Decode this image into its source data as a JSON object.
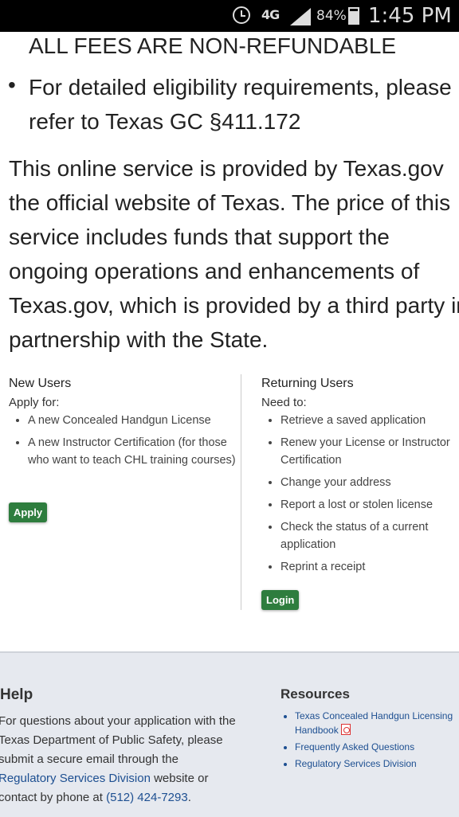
{
  "status_bar": {
    "network": "4G",
    "battery": "84%",
    "time": "1:45 PM"
  },
  "notice": {
    "fees": "ALL FEES ARE NON-REFUNDABLE",
    "eligibility": "For detailed eligibility requirements, please refer to Texas GC §411.172"
  },
  "service_text": "This online service is provided by Texas.gov the official website of Texas. The price of this service includes funds that support the ongoing operations and enhancements of Texas.gov, which is provided by a third party in partnership with the State.",
  "new_users": {
    "title": "New Users",
    "subtitle": "Apply for:",
    "items": [
      "A new Concealed Handgun License",
      "A new Instructor Certification (for those who want to teach CHL training courses)"
    ],
    "button": "Apply"
  },
  "returning_users": {
    "title": "Returning Users",
    "subtitle": "Need to:",
    "items": [
      "Retrieve a saved application",
      "Renew your License or Instructor Certification",
      "Change your address",
      "Report a lost or stolen license",
      "Check the status of a current application",
      "Reprint a receipt"
    ],
    "button": "Login"
  },
  "footer": {
    "help_title": "Help",
    "help_text_1": "For questions about your application with the Texas Department of Public Safety, please submit a secure email through the",
    "help_link": "Regulatory Services Division",
    "help_text_2": "website or contact by phone at",
    "help_phone": "(512) 424-7293",
    "help_end": ".",
    "resources_title": "Resources",
    "resources": [
      "Texas Concealed Handgun Licensing Handbook",
      "Frequently Asked Questions",
      "Regulatory Services Division"
    ]
  },
  "icons": [
    "alarm-icon",
    "signal-icon",
    "battery-icon",
    "pdf-icon"
  ]
}
